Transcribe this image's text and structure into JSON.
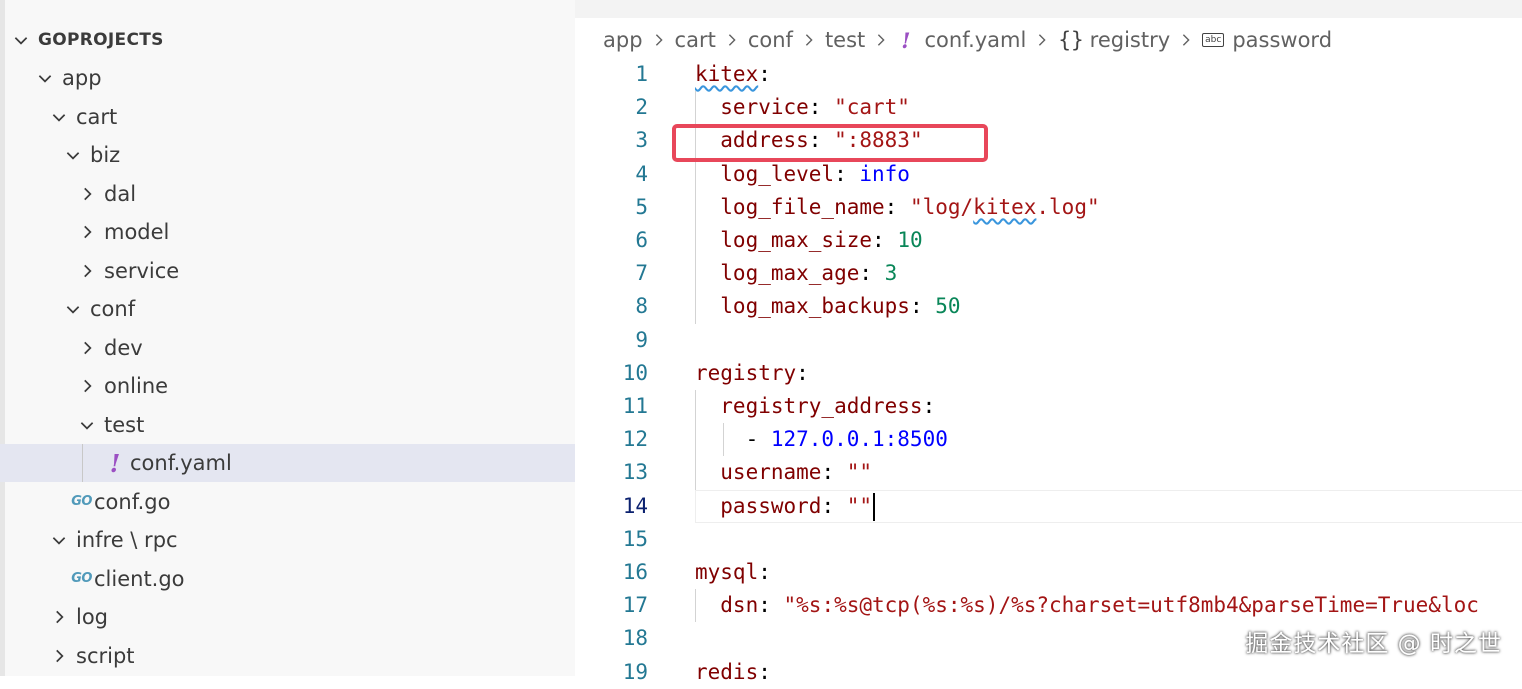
{
  "explorer": {
    "root": "GOPROJECTS",
    "items": [
      {
        "label": "app",
        "type": "folder",
        "expanded": true
      },
      {
        "label": "cart",
        "type": "folder",
        "expanded": true
      },
      {
        "label": "biz",
        "type": "folder",
        "expanded": true
      },
      {
        "label": "dal",
        "type": "folder",
        "expanded": false
      },
      {
        "label": "model",
        "type": "folder",
        "expanded": false
      },
      {
        "label": "service",
        "type": "folder",
        "expanded": false
      },
      {
        "label": "conf",
        "type": "folder",
        "expanded": true
      },
      {
        "label": "dev",
        "type": "folder",
        "expanded": false
      },
      {
        "label": "online",
        "type": "folder",
        "expanded": false
      },
      {
        "label": "test",
        "type": "folder",
        "expanded": true
      },
      {
        "label": "conf.yaml",
        "type": "yaml",
        "selected": true,
        "icon": "!"
      },
      {
        "label": "conf.go",
        "type": "go",
        "icon": "GO"
      },
      {
        "label": "infre \\ rpc",
        "type": "folder",
        "expanded": true
      },
      {
        "label": "client.go",
        "type": "go",
        "icon": "GO"
      },
      {
        "label": "log",
        "type": "folder",
        "expanded": false
      },
      {
        "label": "script",
        "type": "folder",
        "expanded": false
      }
    ]
  },
  "breadcrumb": {
    "parts": [
      "app",
      "cart",
      "conf",
      "test"
    ],
    "yaml_icon": "!",
    "file": "conf.yaml",
    "brace_icon": "{}",
    "object": "registry",
    "abc_icon": "abc",
    "field": "password"
  },
  "editor": {
    "active_line": 14,
    "lines": [
      {
        "n": "1",
        "code": [
          [
            "k sq",
            "kitex"
          ],
          [
            "p",
            ":"
          ]
        ]
      },
      {
        "n": "2",
        "code": [
          [
            "k",
            "  service"
          ],
          [
            "p",
            ": "
          ],
          [
            "s",
            "\"cart\""
          ]
        ]
      },
      {
        "n": "3",
        "code": [
          [
            "k",
            "  address"
          ],
          [
            "p",
            ": "
          ],
          [
            "s",
            "\":8883\""
          ]
        ]
      },
      {
        "n": "4",
        "code": [
          [
            "k",
            "  log_level"
          ],
          [
            "p",
            ": "
          ],
          [
            "b",
            "info"
          ]
        ]
      },
      {
        "n": "5",
        "code": [
          [
            "k",
            "  log_file_name"
          ],
          [
            "p",
            ": "
          ],
          [
            "s",
            "\"log/"
          ],
          [
            "s sq",
            "kitex"
          ],
          [
            "s",
            ".log\""
          ]
        ]
      },
      {
        "n": "6",
        "code": [
          [
            "k",
            "  log_max_size"
          ],
          [
            "p",
            ": "
          ],
          [
            "n",
            "10"
          ]
        ]
      },
      {
        "n": "7",
        "code": [
          [
            "k",
            "  log_max_age"
          ],
          [
            "p",
            ": "
          ],
          [
            "n",
            "3"
          ]
        ]
      },
      {
        "n": "8",
        "code": [
          [
            "k",
            "  log_max_backups"
          ],
          [
            "p",
            ": "
          ],
          [
            "n",
            "50"
          ]
        ]
      },
      {
        "n": "9",
        "code": []
      },
      {
        "n": "10",
        "code": [
          [
            "k",
            "registry"
          ],
          [
            "p",
            ":"
          ]
        ]
      },
      {
        "n": "11",
        "code": [
          [
            "k",
            "  registry_address"
          ],
          [
            "p",
            ":"
          ]
        ]
      },
      {
        "n": "12",
        "code": [
          [
            "p",
            "    - "
          ],
          [
            "b",
            "127.0.0.1:8500"
          ]
        ]
      },
      {
        "n": "13",
        "code": [
          [
            "k",
            "  username"
          ],
          [
            "p",
            ": "
          ],
          [
            "s",
            "\"\""
          ]
        ]
      },
      {
        "n": "14",
        "code": [
          [
            "k",
            "  password"
          ],
          [
            "p",
            ": "
          ],
          [
            "s",
            "\"\""
          ]
        ]
      },
      {
        "n": "15",
        "code": []
      },
      {
        "n": "16",
        "code": [
          [
            "k",
            "mysql"
          ],
          [
            "p",
            ":"
          ]
        ]
      },
      {
        "n": "17",
        "code": [
          [
            "k",
            "  dsn"
          ],
          [
            "p",
            ": "
          ],
          [
            "s",
            "\"%s:%s@tcp(%s:%s)/%s?charset=utf8mb4&parseTime=True&loc"
          ]
        ]
      },
      {
        "n": "18",
        "code": []
      },
      {
        "n": "19",
        "code": [
          [
            "k",
            "redis"
          ],
          [
            "p",
            ":"
          ]
        ]
      }
    ]
  },
  "watermark": "掘金技术社区 @ 时之世",
  "colors": {
    "highlight": "#e8475a",
    "selected_row": "#e4e6f1",
    "line_number": "#237893"
  }
}
